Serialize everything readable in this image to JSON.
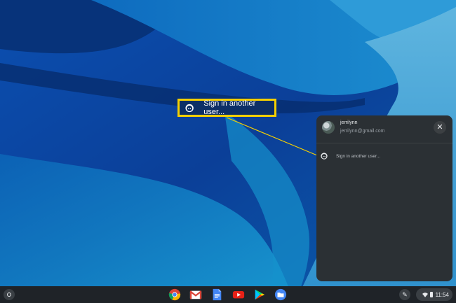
{
  "callout": {
    "label": "Sign in another user..."
  },
  "user_menu": {
    "user_name": "jerrilynn",
    "user_email": "jerrilynn@gmail.com",
    "close_symbol": "✕",
    "sign_in_label": "Sign in another user..."
  },
  "shelf": {
    "apps": [
      "chrome-icon",
      "gmail-icon",
      "docs-icon",
      "youtube-icon",
      "play-store-icon",
      "files-icon"
    ],
    "pen_symbol": "✎",
    "clock": "11:54"
  },
  "colors": {
    "highlight": "#f5d000",
    "panel": "#2b3034",
    "shelf": "#1f2328"
  }
}
